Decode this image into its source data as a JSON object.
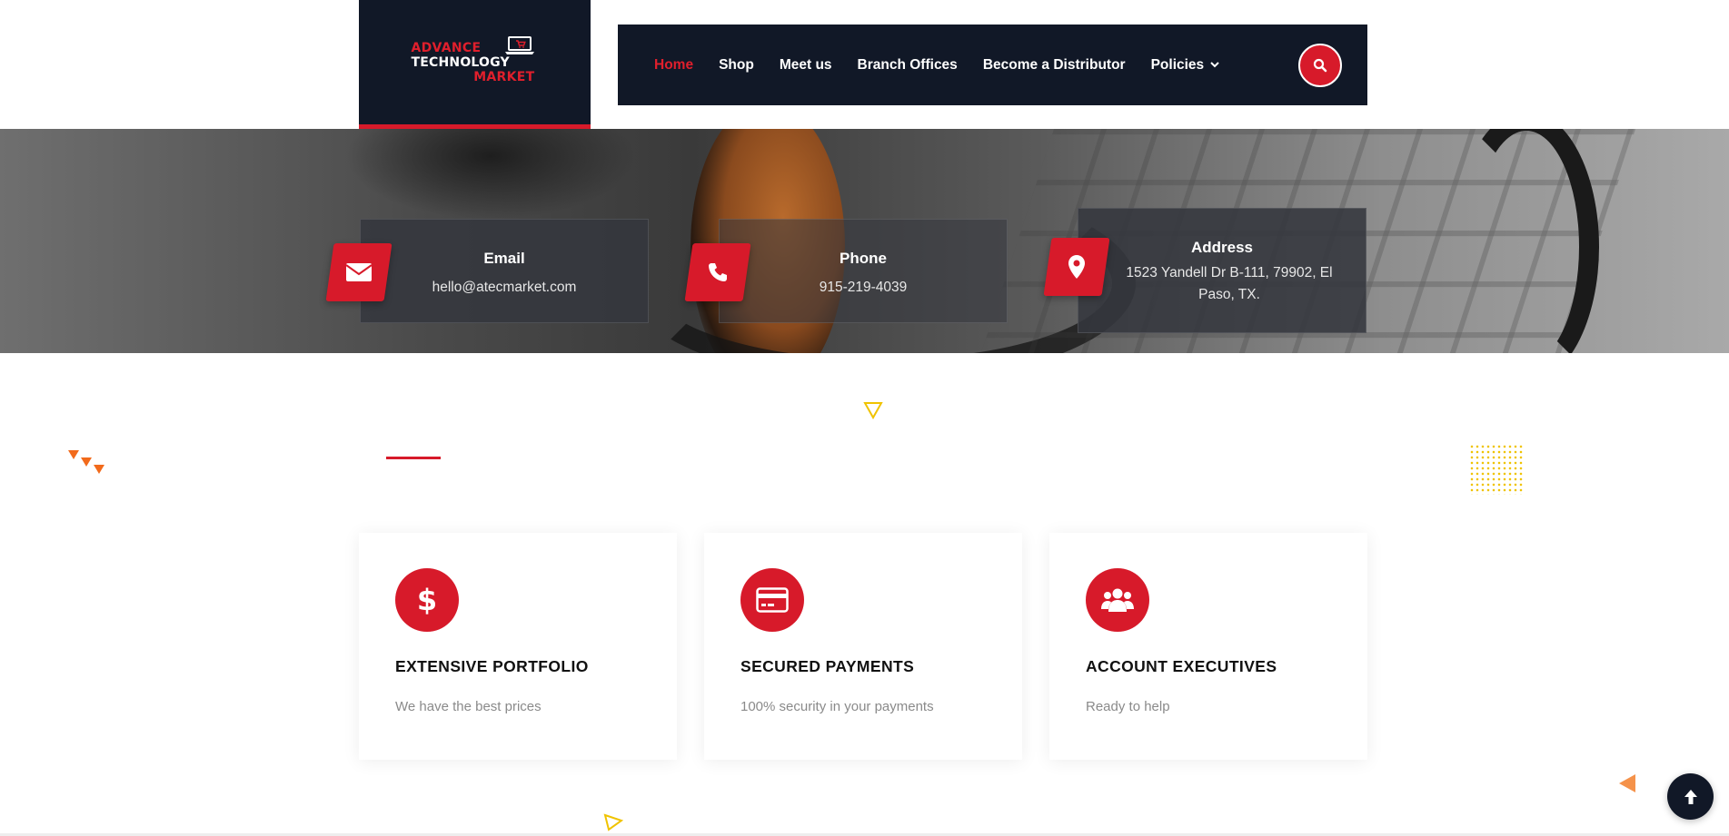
{
  "logo": {
    "line1": "ADVANCE",
    "line2": "TECHNOLOGY",
    "line3": "MARKET"
  },
  "nav": {
    "items": [
      {
        "label": "Home",
        "active": true
      },
      {
        "label": "Shop",
        "active": false
      },
      {
        "label": "Meet us",
        "active": false
      },
      {
        "label": "Branch Offices",
        "active": false
      },
      {
        "label": "Become a Distributor",
        "active": false
      },
      {
        "label": "Policies",
        "active": false,
        "has_dropdown": true
      }
    ],
    "search_icon": "search-icon"
  },
  "contact": {
    "email": {
      "title": "Email",
      "value": "hello@atecmarket.com",
      "icon": "envelope-icon"
    },
    "phone": {
      "title": "Phone",
      "value": "915-219-4039",
      "icon": "phone-icon"
    },
    "address": {
      "title": "Address",
      "value": "1523 Yandell Dr B-111, 79902, El Paso, TX.",
      "icon": "map-marker-icon"
    }
  },
  "features": [
    {
      "title": "EXTENSIVE PORTFOLIO",
      "description": "We have the best prices",
      "icon": "dollar-icon"
    },
    {
      "title": "SECURED PAYMENTS",
      "description": "100% security in your payments",
      "icon": "credit-card-icon"
    },
    {
      "title": "ACCOUNT EXECUTIVES",
      "description": "Ready to help",
      "icon": "users-icon"
    }
  ],
  "colors": {
    "brand_red": "#d71a2a",
    "navy": "#111827",
    "accent_yellow": "#f0c300",
    "accent_orange": "#f26a1b"
  }
}
